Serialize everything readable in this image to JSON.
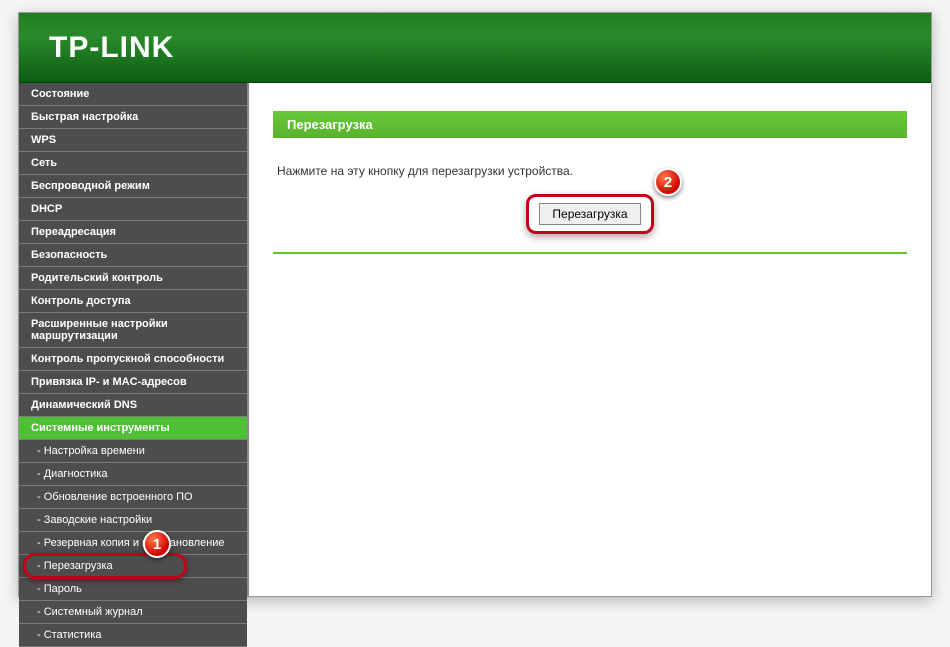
{
  "header": {
    "logo": "TP-LINK"
  },
  "sidebar": {
    "items": [
      {
        "label": "Состояние"
      },
      {
        "label": "Быстрая настройка"
      },
      {
        "label": "WPS"
      },
      {
        "label": "Сеть"
      },
      {
        "label": "Беспроводной режим"
      },
      {
        "label": "DHCP"
      },
      {
        "label": "Переадресация"
      },
      {
        "label": "Безопасность"
      },
      {
        "label": "Родительский контроль"
      },
      {
        "label": "Контроль доступа"
      },
      {
        "label": "Расширенные настройки маршрутизации"
      },
      {
        "label": "Контроль пропускной способности"
      },
      {
        "label": "Привязка IP- и MAC-адресов"
      },
      {
        "label": "Динамический DNS"
      },
      {
        "label": "Системные инструменты",
        "active": true
      }
    ],
    "sub_items": [
      {
        "label": "- Настройка времени"
      },
      {
        "label": "- Диагностика"
      },
      {
        "label": "- Обновление встроенного ПО"
      },
      {
        "label": "- Заводские настройки"
      },
      {
        "label": "- Резервная копия и восстановление"
      },
      {
        "label": "- Перезагрузка",
        "highlight": true
      },
      {
        "label": "- Пароль"
      },
      {
        "label": "- Системный журнал"
      },
      {
        "label": "- Статистика"
      }
    ]
  },
  "main": {
    "title": "Перезагрузка",
    "instruction": "Нажмите на эту кнопку для перезагрузки устройства.",
    "button_label": "Перезагрузка"
  },
  "markers": {
    "one": "1",
    "two": "2"
  }
}
